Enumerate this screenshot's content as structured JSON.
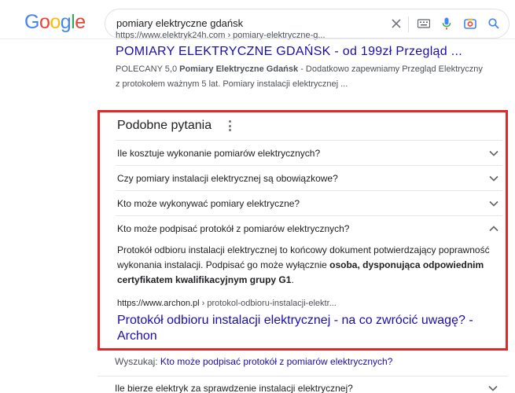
{
  "header": {
    "logo_letters": [
      {
        "ch": "G",
        "color": "#4285F4"
      },
      {
        "ch": "o",
        "color": "#EA4335"
      },
      {
        "ch": "o",
        "color": "#FBBC05"
      },
      {
        "ch": "g",
        "color": "#4285F4"
      },
      {
        "ch": "l",
        "color": "#34A853"
      },
      {
        "ch": "e",
        "color": "#EA4335"
      }
    ],
    "search_query": "pomiary elektryczne gdańsk"
  },
  "top_result": {
    "cite": "https://www.elektryk24h.com › pomiary-elektryczne-g...",
    "title": "POMIARY ELEKTRYCZNE GDAŃSK - od 199zł Przegląd ...",
    "snippet_prefix": "POLECANY 5,0 ",
    "snippet_bold": "Pomiary Elektryczne Gdańsk",
    "snippet_rest": " - Dodatkowo zapewniamy Przegląd Elektryczny z protokołem ważnym 5 lat. Pomiary instalacji elektrycznej ..."
  },
  "paa": {
    "title": "Podobne pytania",
    "questions": [
      {
        "text": "Ile kosztuje wykonanie pomiarów elektrycznych?",
        "expanded": false
      },
      {
        "text": "Czy pomiary instalacji elektrycznej są obowiązkowe?",
        "expanded": false
      },
      {
        "text": "Kto może wykonywać pomiary elektryczne?",
        "expanded": false
      },
      {
        "text": "Kto może podpisać protokół z pomiarów elektrycznych?",
        "expanded": true
      }
    ],
    "answer": {
      "text_plain": "Protokół odbioru instalacji elektrycznej to końcowy dokument potwierdzający poprawność wykonania instalacji. Podpisać go może wyłącznie ",
      "text_bold": "osoba, dysponująca odpowiednim certyfikatem kwalifikacyjnym grupy G1",
      "text_end": ".",
      "cite_domain": "https://www.archon.pl",
      "cite_path": " › protokol-odbioru-instalacji-elektr...",
      "link_title": "Protokół odbioru instalacji elektrycznej - na co zwrócić uwagę? - Archon"
    }
  },
  "search_for": {
    "label": "Wyszukaj:",
    "link": "Kto może podpisać protokół z pomiarów elektrycznych?"
  },
  "bottom_question": "Ile bierze elektryk za sprawdzenie instalacji elektrycznej?",
  "colors": {
    "link": "#1a0dab",
    "highlight_border": "#e02828",
    "mic_blue": "#4285F4"
  }
}
